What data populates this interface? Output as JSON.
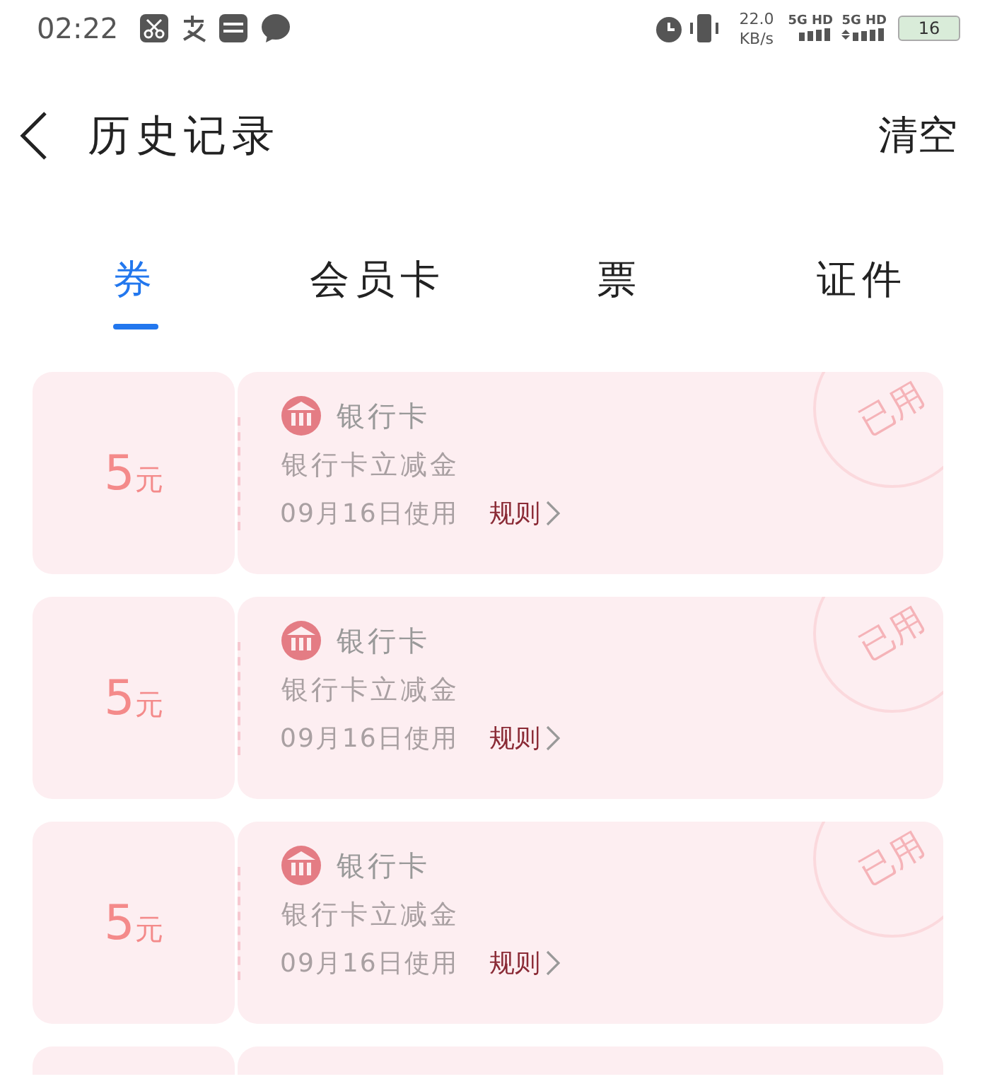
{
  "status_bar": {
    "time": "02:22",
    "speed_value": "22.0",
    "speed_unit": "KB/s",
    "network_1": "5G HD",
    "network_2": "5G HD",
    "battery": "16"
  },
  "header": {
    "title": "历史记录",
    "action": "清空"
  },
  "tabs": [
    {
      "label": "券",
      "selected": true
    },
    {
      "label": "会员卡",
      "selected": false
    },
    {
      "label": "票",
      "selected": false
    },
    {
      "label": "证件",
      "selected": false
    }
  ],
  "coupons": [
    {
      "amount": "5",
      "unit": "元",
      "title": "银行卡",
      "description": "银行卡立减金",
      "date": "09月16日使用",
      "rule": "规则",
      "stamp": "已用"
    },
    {
      "amount": "5",
      "unit": "元",
      "title": "银行卡",
      "description": "银行卡立减金",
      "date": "09月16日使用",
      "rule": "规则",
      "stamp": "已用"
    },
    {
      "amount": "5",
      "unit": "元",
      "title": "银行卡",
      "description": "银行卡立减金",
      "date": "09月16日使用",
      "rule": "规则",
      "stamp": "已用"
    }
  ]
}
